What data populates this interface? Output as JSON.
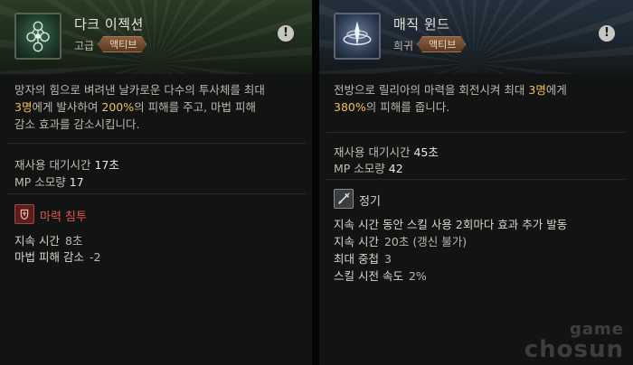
{
  "left": {
    "skill_name": "다크 이젝션",
    "grade": "고급",
    "tag": "액티브",
    "info_icon": "exclamation-icon",
    "description": {
      "line1": "망자의 힘으로 벼려낸 날카로운 다수의 투사체를 최대",
      "line2_hl1": "3명",
      "line2_mid": "에게 발사하여 ",
      "line2_hl2": "200%",
      "line2_end": "의 피해를 주고, 마법 피해",
      "line3": "감소 효과를 감소시킵니다."
    },
    "stats": [
      {
        "label": "재사용 대기시간",
        "value": "17초"
      },
      {
        "label": "MP 소모량",
        "value": "17"
      }
    ],
    "effect": {
      "title": "마력 침투",
      "title_color": "#e0554a",
      "icon": "mana-seep-icon",
      "lines": [
        {
          "label": "지속 시간",
          "value": "8초"
        },
        {
          "label": "마법 피해 감소",
          "value": "-2"
        }
      ]
    }
  },
  "right": {
    "skill_name": "매직 윈드",
    "grade": "희귀",
    "tag": "액티브",
    "info_icon": "exclamation-icon",
    "description": {
      "line1_pre": "전방으로 릴리아의 마력을 회전시켜 최대 ",
      "line1_hl": "3명",
      "line1_end": "에게",
      "line2_hl": "380%",
      "line2_end": "의 피해를 줍니다."
    },
    "stats": [
      {
        "label": "재사용 대기시간",
        "value": "45초"
      },
      {
        "label": "MP 소모량",
        "value": "42"
      }
    ],
    "effect": {
      "title": "정기",
      "title_color": "#d9d5cb",
      "icon": "sword-icon",
      "lines": [
        {
          "label": "지속 시간 동안 스킬 사용 2회마다 효과 추가 발동",
          "value": ""
        },
        {
          "label": "지속 시간",
          "value": "20초 (갱신 불가)"
        },
        {
          "label": "최대 중첩",
          "value": "3"
        },
        {
          "label": "스킬 시전 속도",
          "value": "2%"
        }
      ]
    }
  },
  "watermark": {
    "line1": "game",
    "line2": "chosun"
  },
  "colors": {
    "highlight": "#f2c04f",
    "tag": "#7a5033"
  }
}
